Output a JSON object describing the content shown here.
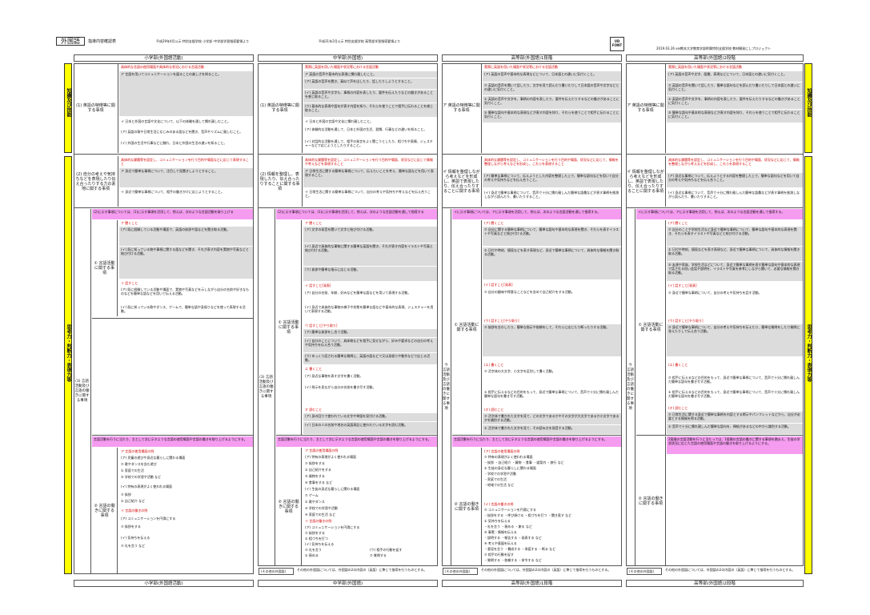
{
  "header": {
    "subject": "外国語",
    "doc_title": "指導内容確認表",
    "source1": "平成29年4月公示 特別支援学校 小学部･中学部学習指導要領より",
    "source2": "平成31年2月公示 特別支援学校 高等部学習指導要領より",
    "logo_text": "UD FONT",
    "info1": "熊本大学教育学部附属特別支援学校 教材開発にしプロジェクト",
    "info2": "2019.03.26 ver."
  },
  "columns": {
    "elem": "小学部(外国語活動)",
    "jr": "中学部(外国語)",
    "h1": "高等部(外国語)1段階",
    "h2": "高等部(外国語)2段階"
  },
  "footer": {
    "elem": "小学部(外国語活動)",
    "jr": "中学部(外国語)",
    "h1": "高等部(外国語)1段階",
    "h2": "高等部(外国語)2段階",
    "other_label": "(その他の外国語)",
    "other_text": "その他の外国語については、外国語の2の内容の〔英語〕に準じて指導を行うものとする。"
  },
  "side": {
    "top": "知識及び技能",
    "bottom": "思考力・判断力・表現力等"
  },
  "elem": {
    "r1_label": "(1) 英語の特徴等に関する事項",
    "r1_red": "具体的な言語の使用場面や具体的な状況における言語活動",
    "r1_a": "ア 言語を用いてコミュニケーションを図ることの楽しさを知ること。",
    "r1_b": "イ 日本と外国の言語や文化について、以下の体験を通して慣れ親しむこと。",
    "r1_b1": "(ア) 英語の歌や日常生活になじみのある語などを聞き、音声やリズムに親しむこと。",
    "r1_b2": "(イ) 外国の生活や行事などに触れ、日本と外国の生活の違いを知ること。",
    "r2_label": "(2) 自分の考えや気持ちなどを表現したり伝え合ったりする力の素地に関する事項",
    "r2_red": "具体的な課題等を設定し、コミュニケーションを行う目的や場面などに応じて表現すること",
    "r2_a": "ア 身近で簡単な事柄について、注目して見聞きしようとすること。",
    "r2_b": "イ 身近で簡単な事柄について、相手の働きかけに応じようとすること。",
    "r3_label": "(3) 言語活動及び言語の働きに関する事項",
    "r3_pink": "(2)に示す事項については、(1)に示す事項を活用して、例えば、次のような言語活動を取り上げる",
    "act_label": "① 言語活動に関する事項",
    "listen_h": "ア 聞くこと",
    "listen1": "(ア) 既に経験している活動や場面で、英語の挨拶や語などを聞き取る活動。",
    "listen2": "(イ) 既に知っている物や事柄に関する語などを聞き、それが表す内容を実物や写真などと結び付ける活動。",
    "speak_h": "イ 話すこと",
    "speak1": "(ア) 既に経験している活動や場面で、実物や写真などを示しながら自分の名前や好きなものなどを簡単な語などを用いて伝える活動。",
    "speak2": "(イ) 既に知っている歌やダンス、ゲームで、簡単な語や身振りなどを使って表現する活動。",
    "func_label": "② 言語の働きに関する事項",
    "func_pink": "言語活動を行うに当たり、主として次に示すような言語の使用場面や言語の働きを取り上げるようにする。",
    "scene_h": "ア 言語の使用場面の例",
    "scene1": "(ア) 児童の遊びや身近な暮らしに関わる場面",
    "scene2": "⑦ 歌やダンスを含む遊び",
    "scene3": "① 家庭での生活",
    "scene4": "⑤ 学校での学習や活動 など",
    "scene5": "(イ) 特有の表現がよく使われる場面",
    "scene6": "⑦ 挨拶",
    "scene7": "① 自己紹介 など",
    "work_h": "イ 言語の働きの例",
    "work1": "(ア) コミュニケーションを円滑にする",
    "work2": "⑦ 挨拶をする",
    "work3": "(イ) 気持ちを伝える",
    "work4": "⑦ 礼を言う など"
  },
  "jr": {
    "r1_label": "(1) 英語の特徴等に関する事項",
    "r1_red": "実際に英語を用いた場面や状況等における言語活動",
    "r1_a": "ア 英語の音声や基本的な表現に慣れ親しむこと。",
    "r1_a1": "(ア) 英語の音声を聞き、真似て声を出したり、話したりしようとすること。",
    "r1_a2": "(イ) 英語の音声や文字も、事柄の内容を表したり、要件を伝えたりなどの働きがあることを感じ取ること。",
    "r1_a3": "(ウ) 基本的な表現や語句が表す内容を知り、それらを使うことで相手に伝わることを感じ取ること。",
    "r1_b": "イ 日本と外国の言語や文化に慣れ親しむこと。",
    "r1_b1": "(ア) 体験的な活動を通して、日本と外国の生活、習慣、行事などの違いを知ること。",
    "r1_b2": "(イ) 対話的な活動を通して、相手の発言をよく聞こうとしたり、相づちや表情、ジェスチャーなどで応じようとしたりすること。",
    "r2_label": "(2) 情報を整理し、表現したり、伝え合ったりすることに関する事項",
    "r2_red": "具体的な課題等を設定し、コミュニケーションを行う目的や場面、状況などに応じて情報や考えなどを表現すること",
    "r2_a": "ア 日常生活に関する簡単な事柄について、伝えたいことを考え、簡単な語などを用いて表現すること。",
    "r2_b": "イ 日常生活に関する簡単な事柄について、自分の考えや気持ちや考えなどを伝え合うこと。",
    "r3_label": "(3) 言語活動及び言語の働きに関する事項",
    "r3_pink": "(2)に示す事項については、(1)に示す事項を活用して、例えば、次のような言語活動を通して指導する",
    "act_label": "① 言語活動に関する事項",
    "listen_h": "ア 聞くこと",
    "listen1": "(ア) 文字の発音を聞いて文字と結び付ける活動。",
    "listen2": "(イ) 身近で具体的な事物に関する簡単な英語を聞き、それが表す内容をイラストや写真と結び付ける活動。",
    "listen3": "(ウ) 挨拶や簡単な指示に応じる活動。",
    "speak_h": "イ 話すこと[発表]",
    "speak1": "(ア) 自分の名前、年齢、好みなどを簡単な語などを用いて表現する活動。",
    "speak2": "(イ) 身近で具体的な事物の様子や状態を簡単な語などや基本的な表現、ジェスチャーを用いて表現する活動。",
    "talk_h": "ウ 話すこと[やり取り]",
    "talk1": "(ア) 簡単な挨拶をし合う活動。",
    "talk2": "(イ) 自分のことについて、具体物などを相手に見せながら、好みや要求などの自分の考えや気持ちを伝え合う活動。",
    "talk3": "(ウ) ゆっくり話される簡単な質問に、英語の語などで又は身振りや動作などで応じる活動。",
    "write_h": "エ 書くこと",
    "write1": "(ア) 身近な事物を表す文字を書く活動。",
    "write2": "(イ) 例示を見ながら自分の名前を書き写す活動。",
    "read_h": "オ 読むこと",
    "read1": "(ア) 身の回りで使われている文字や単語を見付ける活動。",
    "read2": "(イ) 日本の人の名前や地名の英語表記に使われている文字を読む活動。",
    "func_label": "② 言語の働きに関する事項",
    "func_pink": "言語活動を行うに当たり、主として次に示すような言語の使用場面や言語の働きを取り上げるようにする。",
    "scene_h": "ア 言語の使用場面の例",
    "scene1": "(ア) 特有の表現がよく使われる場面",
    "scene2": "⑦ 挨拶をする",
    "scene3": "① 自己紹介をする",
    "scene4": "⑤ 買物をする",
    "scene5": "④ 食事をする など",
    "scene6": "(イ) 生徒の身近な暮らしに関わる場面",
    "scene7": "⑦ ゲーム",
    "scene8": "① 歌やダンス",
    "scene9": "⑤ 学校での学習や活動",
    "scene10": "④ 家庭での生活 など",
    "work_h": "イ 言語の働きの例",
    "work1": "(ア) コミュニケーションを円滑にする",
    "work2": "⑦ 挨拶をする",
    "work3": "① 相づちを打つ",
    "work4": "(イ) 気持ちを伝える",
    "work5": "⑦ 礼を言う",
    "work6": "① 褒める",
    "work7": "(ウ) 相手の行動を促す",
    "work8": "⑦ 質問する"
  },
  "h1": {
    "r1_label": "ア 英語の特徴等に関する事項",
    "r1_red": "実際に英語を用いた場面や状況等における言語活動",
    "r1_a": "(ア) 英語の音声や基本的な表現などについて、日本語との違いに気付くこと。",
    "r1_a1": "⑦ 英語の音声を聞いて話したり、文字を見て読んだり書いたりして日本語の音声や文字などとの違いに気付くこと。",
    "r1_a2": "① 英語の音声や文字を、事柄の内容を表したり、要件を伝えたりするなどの働きがあることに気付くこと。",
    "r1_a3": "⑤ 簡単な語句や基本的な表現などが表す内容を知り、それらを使うことで相手に伝わることに気付くこと。",
    "r2_label": "イ 情報を整理しながら考えなどを形成し、英語で表現したり、伝え合ったりすることに関する事項",
    "r2_red": "具体的な課題等を設定し、コミュニケーションを行う目的や場面、状況などに応じて、情報を整理しながら考えなどを形成し、これらを表現すること",
    "r2_a": "(ア) 簡単な事柄について、伝えようとした内容を整理した上で、簡単な語句などを用いて自分の考えや気持ちなどを伝え合うこと。",
    "r2_b": "(イ) 身近で簡単な事柄について、音声で十分に慣れ親しんだ簡単な語彙などが表す事柄を推測しながら読んだり、書いたりすること。",
    "r3_label": "ウ 言語活動及び言語の働きに関する事項",
    "r3_pink": "イに示す事項については、アに示す事項を活用して、例えば、次のような言語活動を通して指導する。",
    "act_label": "① 言語活動に関する事項",
    "listen_h": "(ア) 聞くこと",
    "listen1": "⑦ 自分に関する簡単な事柄について、簡単な語句や基本的な表現を聞き、それらを表すイラストや写真などと結び付ける活動。",
    "listen2": "① 日付や時刻、値段などを表す表現など、身近で簡単な事柄について、具体的な情報を聞き取る活動。",
    "speak_h": "(イ) 話すこと[発表]",
    "speak1": "⑦ 自分の趣味や得意なことなどを含めて自己紹介をする活動。",
    "talk_h": "(ウ) 話すこと[やり取り]",
    "talk1": "⑦ 挨拶を交わしたり、簡単な指示や依頼をして、それらに応じたり断ったりする活動。",
    "write_h": "(エ) 書くこと",
    "write1": "⑦ 活字体の大文字、小文字を区別して書く活動。",
    "write2": "① 相手に伝えるなどの目的をもって、身近で簡単な事柄について、音声で十分に慣れ親しんだ簡単な語句を書き写す活動。",
    "read_h": "(オ) 読むこと",
    "read1": "⑦ 活字体で書かれた文字を見て、どの文字であるかやその文字が大文字であるか小文字であるかを識別する活動。",
    "read2": "① 活字体で書かれた文字を見て、その読み方を発音する活動。",
    "func_label": "② 言語の働きに関する事項",
    "func_pink": "言語活動を行うに当たり、主として次に示すような言語の使用場面や言語の働きを取り上げるようにする。",
    "scene_h": "(ア) 言語の使用場面の例",
    "scene1": "⑦ 特有の表現がよく使われる場面",
    "scene2": "・挨拶 ・自己紹介 ・買物 ・食事 ・道案内 ・旅行 など",
    "scene3": "① 生徒の身近な暮らしに関わる場面",
    "scene4": "・学校での学習や活動",
    "scene5": "・家庭での生活",
    "scene6": "・地域での生活 など",
    "work_h": "(イ) 言語の働きの例",
    "work1": "⑦ コミュニケーションを円滑にする",
    "work2": "・挨拶をする ・呼び掛ける ・相づちを打つ ・聞き直す など",
    "work3": "① 気持ちを伝える",
    "work4": "・礼を言う ・褒める ・謝る など",
    "work5": "⑤ 事実・情報を伝える",
    "work6": "・説明する ・報告する ・発表する など",
    "work7": "④ 考えや意図を伝える",
    "work8": "・意見を言う ・賛成する ・承諾する ・断る など",
    "work9": "⑦ 相手の行動を促す",
    "work10": "・質問する ・依頼する ・命令する など"
  },
  "h2": {
    "r1_label": "ア 英語の特徴等に関する事項",
    "r1_red": "実際に英語を用いた場面や状況等における言語活動",
    "r1_a": "(ア) 英語の音声や文字、語彙、表現などについて、日本語との違いに気付くこと。",
    "r1_a1": "⑦ 英語の音声を聞いて話したり、簡単な語句などを読んだり書いたりして日本語との違いに気付くこと。",
    "r1_a2": "① 英語の音声や文字を、事柄の内容を表したり、要件を伝えたりするなどの働きがあることに気付くこと。",
    "r1_a3": "⑤ 簡単な語句や基本的な表現などが表す内容を知り、それらを使うことで相手に伝わることに気付くこと。",
    "r2_label": "イ 情報を整理しながら考えなどを形成し、英語で表現したり、伝え合ったりすることに関する事項",
    "r2_red": "具体的な課題等を設定し、コミュニケーションを行う目的や場面、状況などに応じて、情報を整理しながら考えなどを形成し、これらを表現すること",
    "r2_a": "(ア) 身近な事柄について、伝えようとする内容を整理した上で、簡単な語句などを用いて自分の考えや気持ちなどを伝え合うこと。",
    "r2_b": "(イ) 身近な事柄について、音声で十分に慣れ親しんだ簡単な語彙などが表す事柄を推測しながら読んだり、書いたりすること。",
    "r3_label": "ウ 言語活動及び言語の働きに関する事項",
    "r3_pink": "イに示す事項については、アに示す事項を活用して、例えば、次のような言語活動を通して指導する。",
    "act_label": "① 言語活動に関する事項",
    "listen_h": "(ア) 聞くこと",
    "listen1": "⑦ 自分のことや学校生活など身近で簡単な事柄について、簡単な語句や基本的な表現を聞き、それらを表すイラストや写真などと結び付ける活動。",
    "listen2": "① 日付や時刻、値段などを表す表現など、身近で簡単な事柄について、具体的な情報を聞き取る活動。",
    "listen3": "⑤ 友達や家族、学校生活などについて、身近で簡単な事柄を表す簡単な語句や基本的な表現で話される短い会話や説明を、イラストや写真を参考にしながら聞いて、必要な情報を聞き取る活動。",
    "speak_h": "(イ) 話すこと[発表]",
    "speak1": "⑦ 身近で簡単な事柄について、自分の考えや気持ちを話す活動。",
    "talk_h": "(ウ) 話すこと[やり取り]",
    "talk1": "⑦ 身近で簡単な事柄について、自分の考えや気持ちを伝えたり、簡単な質問をしたり質問に答えたりして伝え合う活動。",
    "write_h": "(エ) 書くこと",
    "write1": "⑦ 相手に伝えるなどの目的をもって、身近で簡単な事柄について、音声で十分に慣れ親しんだ簡単な語句を書き写す活動。",
    "write2": "① 相手に伝えるなどの目的をもって、身近で簡単な事柄について、音声で十分に慣れ親しんだ簡単な語句を書き写す活動。",
    "read_h": "(オ) 読むこと",
    "read1": "⑦ 日常生活に関する身近で簡単な事柄を内容とする掲示やパンフレットなどから、自分が必要とする情報を得る活動。",
    "read2": "① 音声で十分に慣れ親しんだ簡単な語句を、挿絵があるなどの中から識別する活動。",
    "func_pink": "2段階の言語活動を行うに当たっては、1段階の言語の働きに関する事項を踏まえ、生徒の学習状況に応じた言語の使用場面や言語の働きを取り上げるようにする。",
    "func_label": "② 言語の働きに関する事項"
  }
}
